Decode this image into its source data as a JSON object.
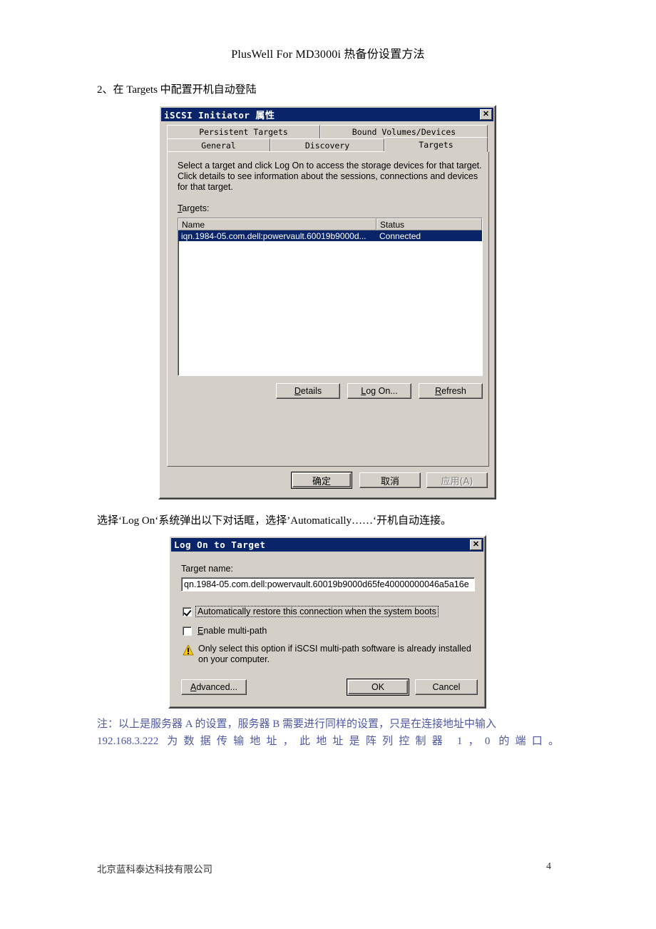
{
  "document": {
    "title": "PlusWell For MD3000i  热备份设置方法",
    "step_text": "2、在 Targets 中配置开机自动登陆",
    "mid_text": "选择‘Log On‘系统弹出以下对话眶，选择’Automatically……‘开机自动连接。",
    "note_line1": "注：以上是服务器 A 的设置，服务器 B 需要进行同样的设置，只是在连接地址中输入",
    "note_line2": "192.168.3.222 为数据传输地址，此地址是阵列控制器 1，0 的端口。",
    "note_color": "#4e57a8",
    "footer_company": "北京蓝科泰达科技有限公司",
    "footer_page": "4"
  },
  "iscsi_dialog": {
    "title_ascii": "iSCSI Initiator ",
    "title_cjk": "属性",
    "close_label": "✕",
    "tabs_row_top": [
      {
        "label": "Persistent Targets",
        "active": false
      },
      {
        "label": "Bound Volumes/Devices",
        "active": false
      }
    ],
    "tabs_row_bottom": [
      {
        "label": "General",
        "active": false
      },
      {
        "label": "Discovery",
        "active": false
      },
      {
        "label": "Targets",
        "active": true
      }
    ],
    "description": "Select a target and click Log On to access the storage devices for that target. Click details to see information about the sessions, connections and devices for that target.",
    "targets_label_prefix": "T",
    "targets_label_rest": "argets:",
    "listview": {
      "columns": [
        "Name",
        "Status"
      ],
      "rows": [
        {
          "name": "iqn.1984-05.com.dell:powervault.60019b9000d...",
          "status": "Connected",
          "selected": true
        }
      ]
    },
    "action_buttons": [
      {
        "accel": "D",
        "rest": "etails"
      },
      {
        "accel": "L",
        "rest": "og On..."
      },
      {
        "accel": "R",
        "rest": "efresh"
      }
    ],
    "footer_buttons": [
      {
        "label": "确定",
        "style": "default"
      },
      {
        "label": "取消",
        "style": "normal"
      },
      {
        "label": "应用(A)",
        "style": "disabled"
      }
    ]
  },
  "logon_dialog": {
    "title": "Log On to Target",
    "close_label": "✕",
    "target_name_label": "Target name:",
    "target_name_value": "qn.1984-05.com.dell:powervault.60019b9000d65fe40000000046a5a16e",
    "checkbox_auto": {
      "label": "Automatically restore this connection when the system boots",
      "checked": true,
      "focused": true
    },
    "checkbox_multipath": {
      "accel": "E",
      "rest": "nable multi-path",
      "checked": false
    },
    "warning_text": "Only select this option if iSCSI multi-path software is already installed on your computer.",
    "warning_color": "#ffcc00",
    "buttons": {
      "advanced_accel": "A",
      "advanced_rest": "dvanced...",
      "ok": "OK",
      "cancel": "Cancel"
    }
  }
}
